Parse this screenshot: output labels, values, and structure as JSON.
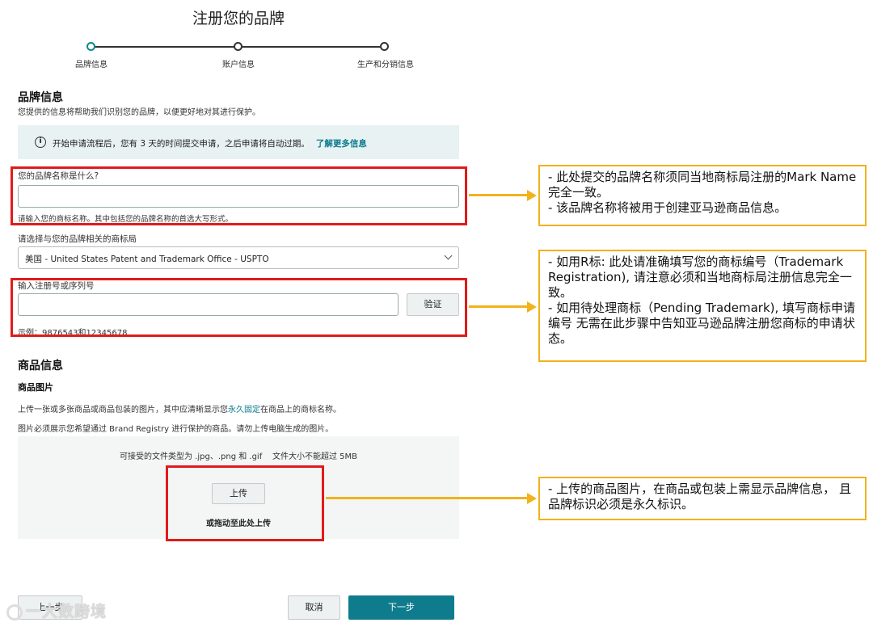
{
  "page_title": "注册您的品牌",
  "stepper": {
    "steps": [
      "品牌信息",
      "账户信息",
      "生产和分销信息"
    ],
    "active_index": 0
  },
  "brand_section": {
    "title": "品牌信息",
    "description": "您提供的信息将帮助我们识别您的品牌，以便更好地对其进行保护。",
    "info_banner": {
      "icon": "info-icon",
      "text": "开始申请流程后，您有 3 天的时间提交申请，之后申请将自动过期。",
      "link": "了解更多信息"
    },
    "brand_name": {
      "label": "您的品牌名称是什么?",
      "value": "",
      "hint": "请输入您的商标名称。其中包括您的品牌名称的首选大写形式。"
    },
    "trademark_office": {
      "label": "请选择与您的品牌相关的商标局",
      "selected": "美国 - United States Patent and Trademark Office - USPTO"
    },
    "registration_number": {
      "label": "输入注册号或序列号",
      "value": "",
      "verify_button": "验证",
      "example": "示例：9876543和12345678"
    }
  },
  "product_section": {
    "title": "商品信息",
    "images_title": "商品图片",
    "instruction_prefix": "上传一张或多张商品或商品包装的图片，其中应清晰显示您",
    "instruction_link": "永久固定",
    "instruction_suffix": "在商品上的商标名称。",
    "instruction2": "图片必须展示您希望通过 Brand Registry 进行保护的商品。请勿上传电脑生成的图片。",
    "file_types": "可接受的文件类型为 .jpg、.png 和 .gif    文件大小不能超过 5MB",
    "upload_button": "上传",
    "drag_text": "或拖动至此处上传"
  },
  "footer": {
    "back_button": "上一步",
    "cancel_button": "取消",
    "next_button": "下一步"
  },
  "annotations": {
    "note1": "- 此处提交的品牌名称须同当地商标局注册的Mark Name 完全一致。\n- 该品牌名称将被用于创建亚马逊商品信息。",
    "note2": "- 如用R标: 此处请准确填写您的商标编号（Trademark Registration), 请注意必须和当地商标局注册信息完全一致。\n- 如用待处理商标（Pending Trademark), 填写商标申请编号 无需在此步骤中告知亚马逊品牌注册您商标的申请状态。",
    "note3": "- 上传的商品图片，在商品或包装上需显示品牌信息， 且品牌标识必须是永久标识。",
    "highlight_color": "#e01b1b",
    "note_border_color": "#f2b21b"
  },
  "watermark": "一大数跨境",
  "accent_color": "#0f7c8d"
}
